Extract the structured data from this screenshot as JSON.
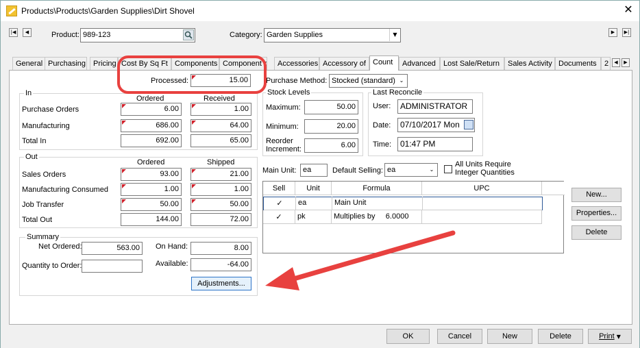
{
  "window": {
    "title": "Products\\Products\\Garden Supplies\\Dirt Shovel"
  },
  "header": {
    "product_label": "Product:",
    "product_value": "989-123",
    "category_label": "Category:",
    "category_value": "Garden Supplies"
  },
  "tabs": [
    {
      "label": "General"
    },
    {
      "label": "Purchasing"
    },
    {
      "label": "Pricing"
    },
    {
      "label": "Cost By Sq Ft"
    },
    {
      "label": "Components"
    },
    {
      "label": "Component of"
    },
    {
      "label": "Accessories"
    },
    {
      "label": "Accessory of"
    },
    {
      "label": "Count"
    },
    {
      "label": "Advanced"
    },
    {
      "label": "Lost Sale/Return"
    },
    {
      "label": "Sales Activity"
    },
    {
      "label": "Documents"
    },
    {
      "label": "2"
    }
  ],
  "processed": {
    "label": "Processed:",
    "value": "15.00"
  },
  "purchase_method": {
    "label": "Purchase Method:",
    "value": "Stocked (standard)"
  },
  "in_group": {
    "caption": "In",
    "col_ordered": "Ordered",
    "col_received": "Received",
    "rows": [
      {
        "label": "Purchase Orders",
        "ordered": "6.00",
        "received": "1.00"
      },
      {
        "label": "Manufacturing",
        "ordered": "686.00",
        "received": "64.00"
      },
      {
        "label": "Total In",
        "ordered": "692.00",
        "received": "65.00"
      }
    ]
  },
  "out_group": {
    "caption": "Out",
    "col_ordered": "Ordered",
    "col_shipped": "Shipped",
    "rows": [
      {
        "label": "Sales Orders",
        "ordered": "93.00",
        "shipped": "21.00"
      },
      {
        "label": "Manufacturing Consumed",
        "ordered": "1.00",
        "shipped": "1.00"
      },
      {
        "label": "Job Transfer",
        "ordered": "50.00",
        "shipped": "50.00"
      },
      {
        "label": "Total Out",
        "ordered": "144.00",
        "shipped": "72.00"
      }
    ]
  },
  "summary": {
    "caption": "Summary",
    "net_ordered_label": "Net Ordered:",
    "net_ordered_value": "563.00",
    "on_hand_label": "On Hand:",
    "on_hand_value": "8.00",
    "qty_to_order_label": "Quantity to Order:",
    "qty_to_order_value": "",
    "available_label": "Available:",
    "available_value": "-64.00",
    "adjustments_button": "Adjustments..."
  },
  "stock_levels": {
    "caption": "Stock Levels",
    "maximum_label": "Maximum:",
    "maximum_value": "50.00",
    "minimum_label": "Minimum:",
    "minimum_value": "20.00",
    "reorder_label_1": "Reorder",
    "reorder_label_2": "Increment:",
    "reorder_value": "6.00"
  },
  "last_reconcile": {
    "caption": "Last Reconcile",
    "user_label": "User:",
    "user_value": "ADMINISTRATOR",
    "date_label": "Date:",
    "date_value": "07/10/2017 Mon",
    "time_label": "Time:",
    "time_value": "01:47 PM"
  },
  "units": {
    "main_unit_label": "Main Unit:",
    "main_unit_value": "ea",
    "default_selling_label": "Default Selling:",
    "default_selling_value": "ea",
    "integer_label_1": "All Units Require",
    "integer_label_2": "Integer Quantities"
  },
  "unit_grid": {
    "columns": [
      "Sell",
      "Unit",
      "Formula",
      "UPC"
    ],
    "rows": [
      {
        "sell": "✓",
        "unit": "ea",
        "formula": "Main Unit",
        "upc": ""
      },
      {
        "sell": "✓",
        "unit": "pk",
        "formula": "Multiplies by     6.0000",
        "upc": ""
      }
    ]
  },
  "side_buttons": {
    "new": "New...",
    "properties": "Properties...",
    "delete": "Delete"
  },
  "footer": {
    "ok": "OK",
    "cancel": "Cancel",
    "new": "New",
    "delete": "Delete",
    "print": "Print"
  }
}
